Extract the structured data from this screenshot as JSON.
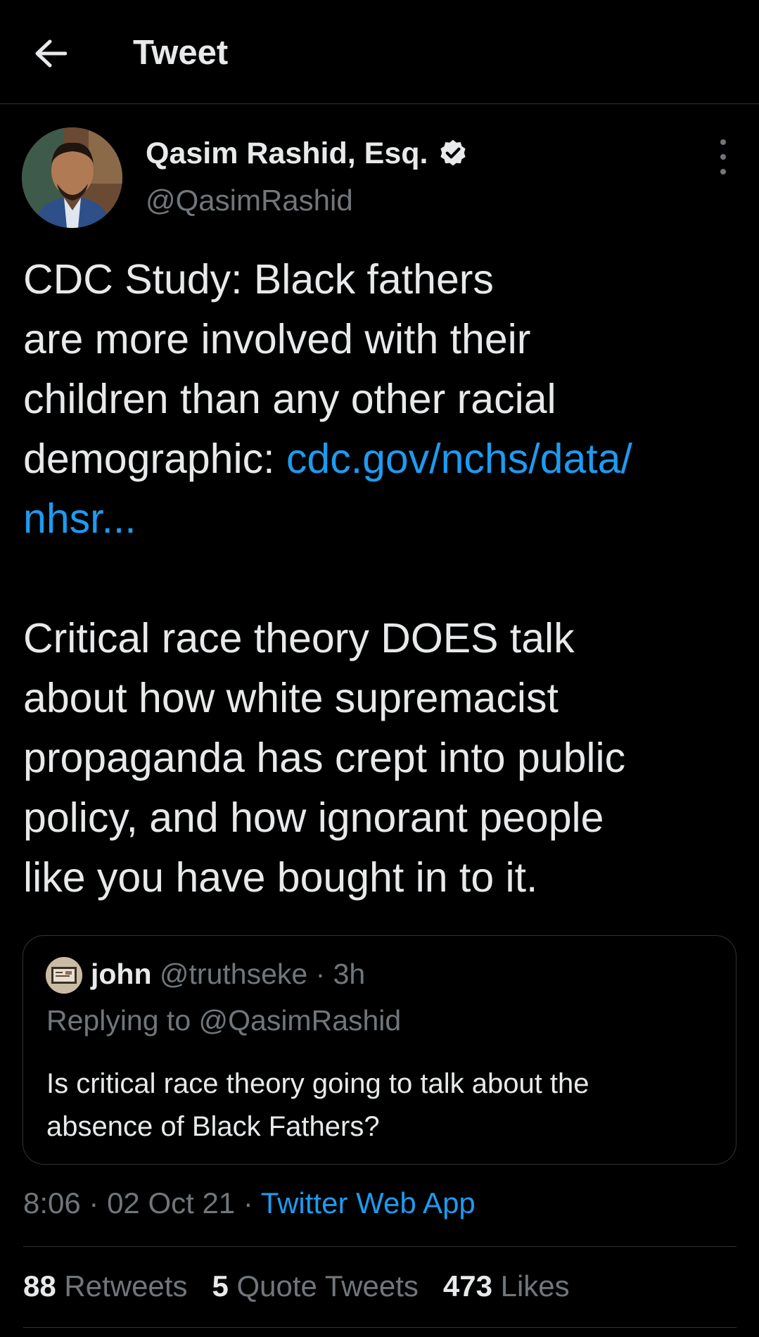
{
  "header": {
    "title": "Tweet",
    "back_icon": "arrow-left-icon"
  },
  "tweet": {
    "author": {
      "name": "Qasim Rashid, Esq.",
      "handle": "@QasimRashid",
      "verified": true
    },
    "text_lines": [
      "CDC Study: Black fathers",
      "are more involved with their",
      "children than any other racial"
    ],
    "text_prefix_line4": "demographic: ",
    "link_part1": "cdc.gov/nchs/data/",
    "link_part2": "nhsr...",
    "text_lines_2": [
      "Critical race theory DOES talk",
      "about how white supremacist",
      "propaganda has crept into public",
      "policy, and how ignorant people",
      "like you have bought in to it."
    ]
  },
  "quote": {
    "name": "john",
    "handle_time": " @truthseke · 3h",
    "replying_to": "Replying to @QasimRashid",
    "text_lines": [
      "Is critical race theory going to talk about the",
      "absence of Black Fathers?"
    ]
  },
  "meta": {
    "time_date": "8:06 · 02 Oct 21 · ",
    "source": "Twitter Web App"
  },
  "stats": {
    "retweets_count": "88",
    "retweets_label": " Retweets",
    "quotes_count": "5",
    "quotes_label": " Quote Tweets",
    "likes_count": "473",
    "likes_label": " Likes"
  },
  "colors": {
    "background": "#000000",
    "text": "#e7e9ea",
    "secondary": "#71767b",
    "link": "#1d9bf0",
    "border": "#2f3336"
  }
}
